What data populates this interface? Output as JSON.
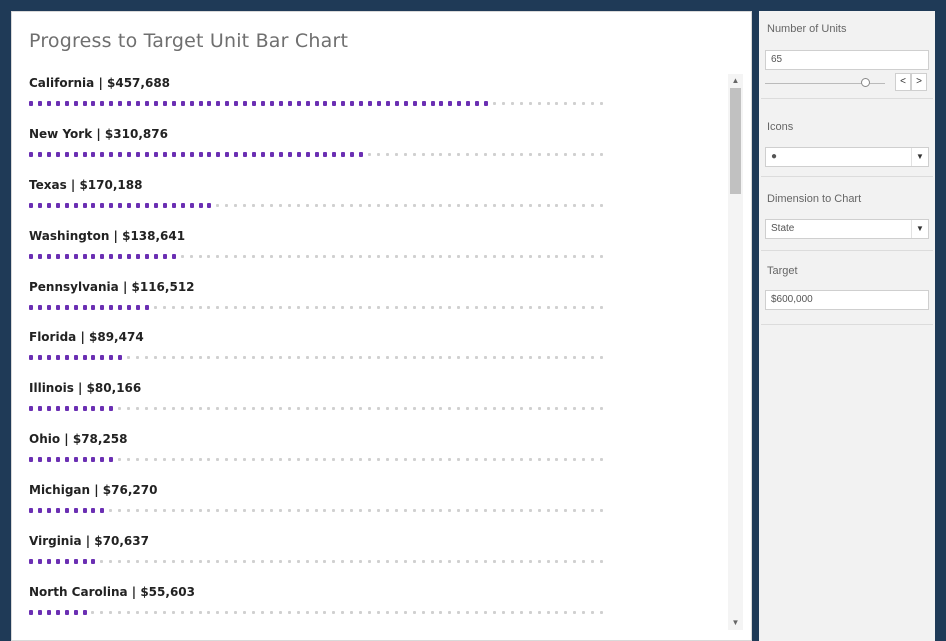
{
  "title": "Progress to Target Unit Bar Chart",
  "colors": {
    "filled": "#6b2fb3",
    "empty": "#d0d0d0"
  },
  "total_units": 65,
  "rows": [
    {
      "label": "California | $457,688",
      "filled_fraction": 0.8
    },
    {
      "label": "New York | $310,876",
      "filled_fraction": 0.58
    },
    {
      "label": "Texas | $170,188",
      "filled_fraction": 0.33
    },
    {
      "label": "Washington | $138,641",
      "filled_fraction": 0.26
    },
    {
      "label": "Pennsylvania | $116,512",
      "filled_fraction": 0.22
    },
    {
      "label": "Florida | $89,474",
      "filled_fraction": 0.17
    },
    {
      "label": "Illinois | $80,166",
      "filled_fraction": 0.15
    },
    {
      "label": "Ohio | $78,258",
      "filled_fraction": 0.15
    },
    {
      "label": "Michigan | $76,270",
      "filled_fraction": 0.14
    },
    {
      "label": "Virginia | $70,637",
      "filled_fraction": 0.13
    },
    {
      "label": "North Carolina | $55,603",
      "filled_fraction": 0.11
    }
  ],
  "sidebar": {
    "units": {
      "title": "Number of Units",
      "value": "65",
      "prev_label": "<",
      "next_label": ">",
      "slider_fraction": 0.83
    },
    "icons": {
      "title": "Icons",
      "value": "●"
    },
    "dimension": {
      "title": "Dimension to Chart",
      "value": "State"
    },
    "target": {
      "title": "Target",
      "value": "$600,000"
    }
  },
  "icons": {
    "dropdown_arrow": "▼",
    "scroll_up": "▲",
    "scroll_down": "▼"
  }
}
